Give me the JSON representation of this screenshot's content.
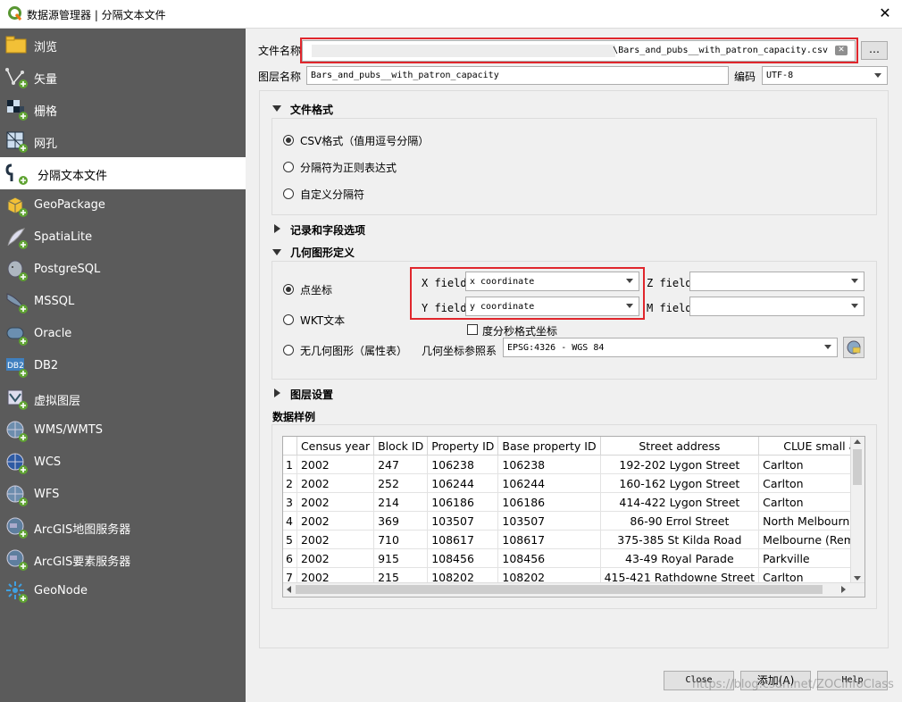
{
  "window": {
    "title": "数据源管理器 | 分隔文本文件",
    "close_glyph": "✕"
  },
  "sidebar": {
    "items": [
      {
        "label": "浏览",
        "icon": "folder-icon"
      },
      {
        "label": "矢量",
        "icon": "vector-layer-icon"
      },
      {
        "label": "栅格",
        "icon": "raster-layer-icon"
      },
      {
        "label": "网孔",
        "icon": "mesh-layer-icon"
      },
      {
        "label": "分隔文本文件",
        "icon": "delimited-text-icon"
      },
      {
        "label": "GeoPackage",
        "icon": "geopackage-icon"
      },
      {
        "label": "SpatiaLite",
        "icon": "spatialite-icon"
      },
      {
        "label": "PostgreSQL",
        "icon": "postgresql-icon"
      },
      {
        "label": "MSSQL",
        "icon": "mssql-icon"
      },
      {
        "label": "Oracle",
        "icon": "oracle-icon"
      },
      {
        "label": "DB2",
        "icon": "db2-icon"
      },
      {
        "label": "虚拟图层",
        "icon": "virtual-layer-icon"
      },
      {
        "label": "WMS/WMTS",
        "icon": "wms-globe-icon"
      },
      {
        "label": "WCS",
        "icon": "wcs-globe-icon"
      },
      {
        "label": "WFS",
        "icon": "wfs-globe-icon"
      },
      {
        "label": "ArcGIS地图服务器",
        "icon": "arcgis-map-icon"
      },
      {
        "label": "ArcGIS要素服务器",
        "icon": "arcgis-feature-icon"
      },
      {
        "label": "GeoNode",
        "icon": "geonode-icon"
      }
    ],
    "active_index": 4
  },
  "file": {
    "label": "文件名称",
    "value": "\\Bars_and_pubs__with_patron_capacity.csv",
    "browse_label": "…"
  },
  "layer": {
    "label": "图层名称",
    "value": "Bars_and_pubs__with_patron_capacity",
    "encoding_label": "编码",
    "encoding_value": "UTF-8"
  },
  "file_format": {
    "title": "文件格式",
    "options": [
      "CSV格式（值用逗号分隔）",
      "分隔符为正则表达式",
      "自定义分隔符"
    ],
    "selected": 0
  },
  "records_title": "记录和字段选项",
  "geometry": {
    "title": "几何图形定义",
    "options": [
      "点坐标",
      "WKT文本",
      "无几何图形（属性表）"
    ],
    "selected": 0,
    "x_label": "X field",
    "x_value": "x coordinate",
    "y_label": "Y field",
    "y_value": "y coordinate",
    "z_label": "Z field",
    "z_value": "",
    "m_label": "M field",
    "m_value": "",
    "dms_label": "度分秒格式坐标",
    "crs_label": "几何坐标参照系",
    "crs_value": "EPSG:4326 - WGS 84"
  },
  "layer_settings_title": "图层设置",
  "sample": {
    "title": "数据样例",
    "columns": [
      "Census year",
      "Block ID",
      "Property ID",
      "Base property ID",
      "Street address",
      "CLUE small area"
    ],
    "rows": [
      [
        "1",
        "2002",
        "247",
        "106238",
        "106238",
        "192-202 Lygon Street",
        "Carlton"
      ],
      [
        "2",
        "2002",
        "252",
        "106244",
        "106244",
        "160-162 Lygon Street",
        "Carlton"
      ],
      [
        "3",
        "2002",
        "214",
        "106186",
        "106186",
        "414-422 Lygon Street",
        "Carlton"
      ],
      [
        "4",
        "2002",
        "369",
        "103507",
        "103507",
        "86-90 Errol Street",
        "North Melbourne"
      ],
      [
        "5",
        "2002",
        "710",
        "108617",
        "108617",
        "375-385 St Kilda Road",
        "Melbourne (Remainder)"
      ],
      [
        "6",
        "2002",
        "915",
        "108456",
        "108456",
        "43-49 Royal Parade",
        "Parkville"
      ],
      [
        "7",
        "2002",
        "215",
        "108202",
        "108202",
        "415-421 Rathdowne Street",
        "Carlton"
      ]
    ]
  },
  "buttons": {
    "close": "Close",
    "add": "添加(A)",
    "help": "Help"
  },
  "colors": {
    "sidebar_bg": "#5b5b5b",
    "highlight_red": "#e0262c"
  },
  "watermark": "https://blog.csdn.net/ZOCinfoClass"
}
